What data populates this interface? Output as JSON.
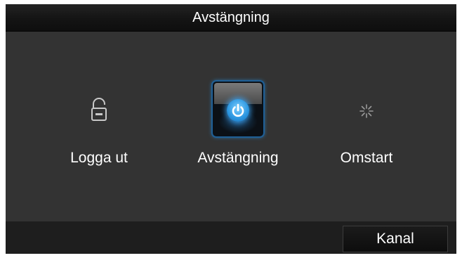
{
  "window": {
    "title": "Avstängning"
  },
  "options": [
    {
      "label": "Logga ut",
      "icon": "unlock-icon",
      "selected": false
    },
    {
      "label": "Avstängning",
      "icon": "power-icon",
      "selected": true
    },
    {
      "label": "Omstart",
      "icon": "restart-icon",
      "selected": false
    }
  ],
  "footer": {
    "button_label": "Kanal"
  },
  "colors": {
    "window_bg": "#333333",
    "titlebar_bg": "#141414",
    "footer_bg": "#1e1e1e",
    "accent_blue": "#2a95e0",
    "text": "#ffffff"
  }
}
